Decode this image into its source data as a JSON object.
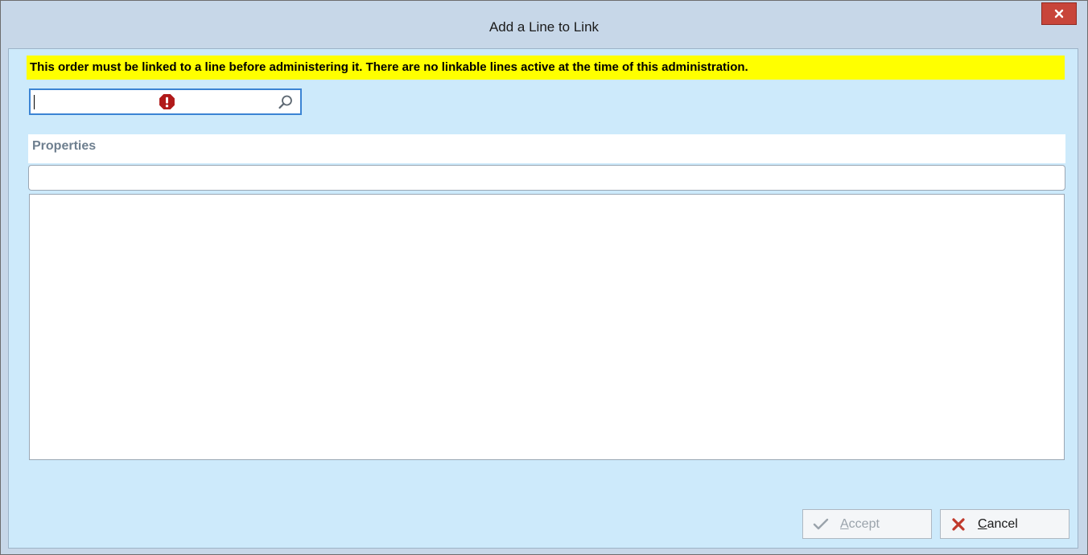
{
  "window": {
    "title": "Add a Line to Link",
    "close_glyph": "x"
  },
  "banner": {
    "message": "This order must be linked to a line before administering it. There are no linkable lines active at the time of this administration.",
    "background": "#ffff00"
  },
  "search": {
    "value": "",
    "icons": [
      "error-icon",
      "search-icon"
    ]
  },
  "properties": {
    "label": "Properties",
    "field_value": ""
  },
  "buttons": {
    "accept_label": "Accept",
    "accept_enabled": false,
    "cancel_label": "Cancel"
  },
  "colors": {
    "client_bg": "#cdeafb",
    "titlebar_bg": "#c7d7e8",
    "close_bg": "#c8453a",
    "focus_border": "#3b84d4"
  }
}
